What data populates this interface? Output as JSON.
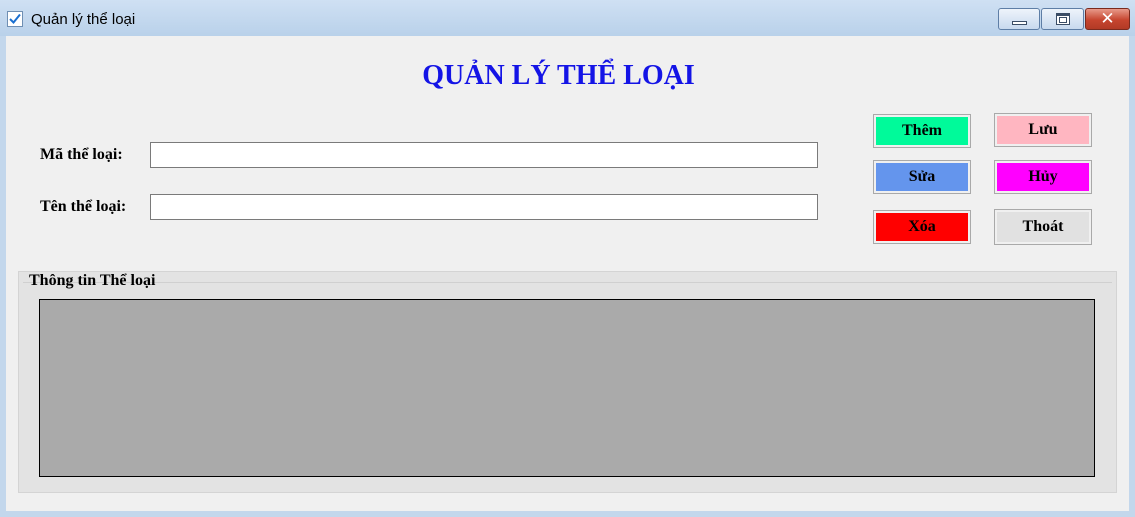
{
  "window": {
    "title": "Quản lý thể loại"
  },
  "heading": "QUẢN LÝ THỂ LOẠI",
  "form": {
    "ma_label": "Mã thể loại:",
    "ma_value": "",
    "ten_label": "Tên thể loại:",
    "ten_value": ""
  },
  "buttons": {
    "them": {
      "label": "Thêm",
      "color": "#00fa9a"
    },
    "luu": {
      "label": "Lưu",
      "color": "#ffb6c1"
    },
    "sua": {
      "label": "Sửa",
      "color": "#6495ed"
    },
    "huy": {
      "label": "Hủy",
      "color": "#ff00ff"
    },
    "xoa": {
      "label": "Xóa",
      "color": "#ff0000"
    },
    "thoat": {
      "label": "Thoát",
      "color": "#e1e1e1"
    }
  },
  "group": {
    "title": "Thông tin Thể loại"
  },
  "colors": {
    "heading": "#1414e6",
    "grid_background": "#aaaaaa"
  },
  "icons": {
    "app": "checkbox-app-icon",
    "minimize": "minimize-icon",
    "maximize": "maximize-icon",
    "close": "close-icon"
  }
}
